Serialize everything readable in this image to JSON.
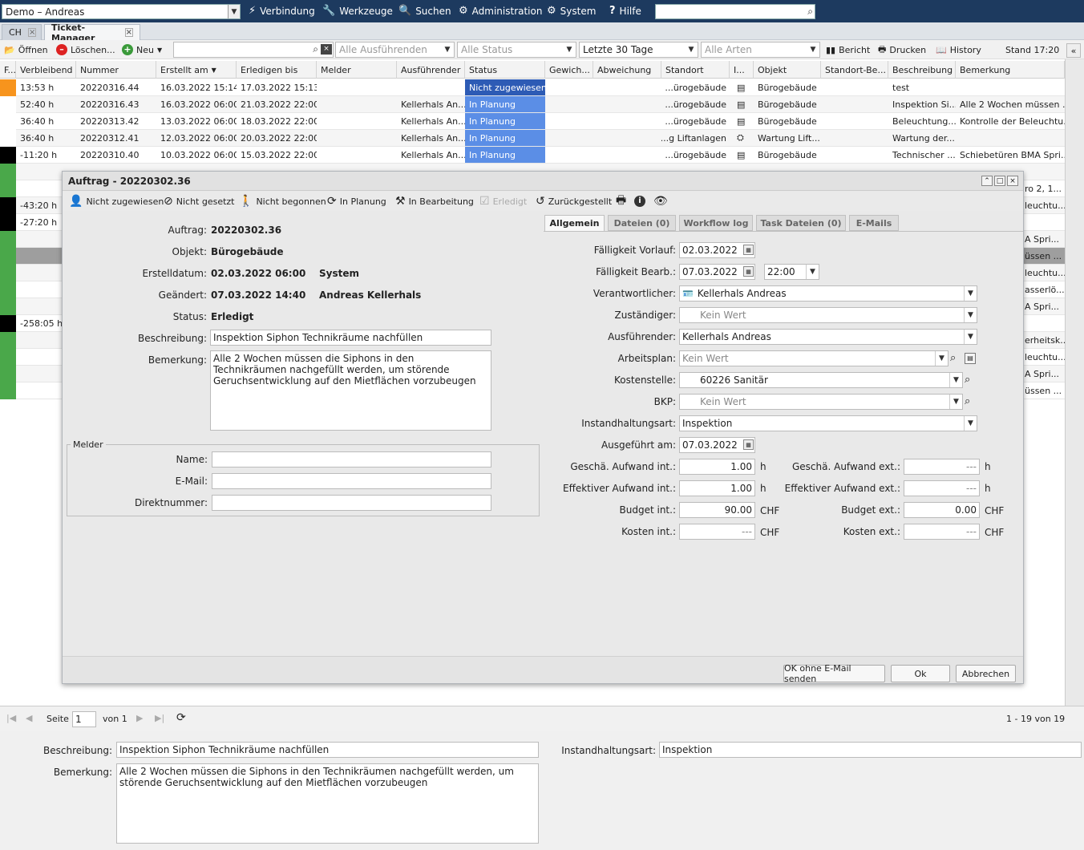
{
  "topbar": {
    "workspace": "Demo – Andreas",
    "menu": [
      {
        "label": "Verbindung",
        "icon": "lightning-icon"
      },
      {
        "label": "Werkzeuge",
        "icon": "wrench-icon"
      },
      {
        "label": "Suchen",
        "icon": "search-icon"
      },
      {
        "label": "Administration",
        "icon": "gears-icon"
      },
      {
        "label": "System",
        "icon": "gear-icon"
      },
      {
        "label": "Hilfe",
        "icon": "help-icon"
      }
    ],
    "search_value": ""
  },
  "tabs": [
    {
      "label": "CH"
    },
    {
      "label": "Ticket-Manager"
    }
  ],
  "toolbar": {
    "open": "Öffnen",
    "delete": "Löschen...",
    "new": "Neu",
    "filter_executor": "Alle Ausführenden",
    "filter_status": "Alle Status",
    "filter_period": "Letzte 30 Tage",
    "filter_kind": "Alle Arten",
    "report": "Bericht",
    "print": "Drucken",
    "history": "History",
    "stand": "Stand 17:20"
  },
  "grid": {
    "columns": [
      "F...",
      "Verbleibend",
      "Nummer",
      "Erstellt am",
      "Erledigen bis",
      "Melder",
      "Ausführender",
      "Status",
      "Gewich...",
      "Abweichung",
      "Standort",
      "I...",
      "Objekt",
      "Standort-Be...",
      "Beschreibung",
      "Bemerkung"
    ],
    "rows": [
      {
        "flag": "#f7941d",
        "verbleibend": "13:53 h",
        "nummer": "20220316.44",
        "erstellt": "16.03.2022 15:14",
        "erledigen": "17.03.2022 15:13",
        "ausf": "",
        "status": "Nicht zugewiesen",
        "standort": "...ürogebäude",
        "objekt": "Bürogebäude",
        "beschreibung": "test",
        "bemerkung": ""
      },
      {
        "flag": "#ffffff",
        "verbleibend": "52:40 h",
        "nummer": "20220316.43",
        "erstellt": "16.03.2022 06:00",
        "erledigen": "21.03.2022 22:00",
        "ausf": "Kellerhals An...",
        "status": "In Planung",
        "standort": "...ürogebäude",
        "objekt": "Bürogebäude",
        "beschreibung": "Inspektion Si...",
        "bemerkung": "Alle 2 Wochen müssen ..."
      },
      {
        "flag": "#ffffff",
        "verbleibend": "36:40 h",
        "nummer": "20220313.42",
        "erstellt": "13.03.2022 06:00",
        "erledigen": "18.03.2022 22:00",
        "ausf": "Kellerhals An...",
        "status": "In Planung",
        "standort": "...ürogebäude",
        "objekt": "Bürogebäude",
        "beschreibung": "Beleuchtung...",
        "bemerkung": "Kontrolle der Beleuchtu..."
      },
      {
        "flag": "#ffffff",
        "verbleibend": "36:40 h",
        "nummer": "20220312.41",
        "erstellt": "12.03.2022 06:00",
        "erledigen": "20.03.2022 22:00",
        "ausf": "Kellerhals An...",
        "status": "In Planung",
        "standort": "...g Liftanlagen",
        "objekt": "Wartung Lift...",
        "beschreibung": "Wartung der...",
        "bemerkung": ""
      },
      {
        "flag": "#000000",
        "verbleibend": "-11:20 h",
        "nummer": "20220310.40",
        "erstellt": "10.03.2022 06:00",
        "erledigen": "15.03.2022 22:00",
        "ausf": "Kellerhals An...",
        "status": "In Planung",
        "standort": "...ürogebäude",
        "objekt": "Bürogebäude",
        "beschreibung": "Technischer ...",
        "bemerkung": "Schiebetüren BMA Spri..."
      }
    ],
    "hidden_rows": [
      {
        "flag": "#4aa84a",
        "verbleibend": "",
        "bemerkung": ""
      },
      {
        "flag": "#4aa84a",
        "verbleibend": "",
        "bemerkung": "ro 2, 1..."
      },
      {
        "flag": "#000000",
        "verbleibend": "-43:20 h",
        "bemerkung": "leuchtu..."
      },
      {
        "flag": "#000000",
        "verbleibend": "-27:20 h",
        "bemerkung": ""
      },
      {
        "flag": "#4aa84a",
        "verbleibend": "",
        "bemerkung": "A Spri..."
      },
      {
        "flag": "#4aa84a",
        "verbleibend": "",
        "bemerkung": "üssen ..."
      },
      {
        "flag": "#4aa84a",
        "verbleibend": "",
        "bemerkung": "leuchtu..."
      },
      {
        "flag": "#4aa84a",
        "verbleibend": "",
        "bemerkung": "asserlö..."
      },
      {
        "flag": "#4aa84a",
        "verbleibend": "",
        "bemerkung": "A Spri..."
      },
      {
        "flag": "#000000",
        "verbleibend": "-258:05 h",
        "bemerkung": ""
      },
      {
        "flag": "#4aa84a",
        "verbleibend": "",
        "bemerkung": "erheitsk..."
      },
      {
        "flag": "#4aa84a",
        "verbleibend": "",
        "bemerkung": "leuchtu..."
      },
      {
        "flag": "#4aa84a",
        "verbleibend": "",
        "bemerkung": "A Spri..."
      },
      {
        "flag": "#4aa84a",
        "verbleibend": "",
        "bemerkung": "üssen ..."
      }
    ]
  },
  "dialog": {
    "title": "Auftrag - 20220302.36",
    "tools": [
      {
        "label": "Nicht zugewiesen",
        "icon": "user-icon"
      },
      {
        "label": "Nicht gesetzt",
        "icon": "block-icon"
      },
      {
        "label": "Nicht begonnen",
        "icon": "walk-icon"
      },
      {
        "label": "In Planung",
        "icon": "refresh-icon"
      },
      {
        "label": "In Bearbeitung",
        "icon": "hammer-icon"
      },
      {
        "label": "Erledigt",
        "icon": "check-icon"
      },
      {
        "label": "Zurückgestellt",
        "icon": "undo-icon"
      }
    ],
    "tabs": [
      "Allgemein",
      "Dateien  (0)",
      "Workflow log",
      "Task Dateien  (0)",
      "E-Mails"
    ],
    "left": {
      "auftrag_label": "Auftrag:",
      "auftrag": "20220302.36",
      "objekt_label": "Objekt:",
      "objekt": "Bürogebäude",
      "erstellt_label": "Erstelldatum:",
      "erstellt": "02.03.2022 06:00",
      "erstellt_by": "System",
      "geaendert_label": "Geändert:",
      "geaendert": "07.03.2022 14:40",
      "geaendert_by": "Andreas Kellerhals",
      "status_label": "Status:",
      "status": "Erledigt",
      "beschreibung_label": "Beschreibung:",
      "beschreibung": "Inspektion Siphon Technikräume nachfüllen",
      "bemerkung_label": "Bemerkung:",
      "bemerkung": "Alle 2 Wochen müssen die Siphons in den Technikräumen nachgefüllt werden, um störende Geruchsentwicklung auf den Mietflächen vorzubeugen",
      "melder_legend": "Melder",
      "name_label": "Name:",
      "email_label": "E-Mail:",
      "direkt_label": "Direktnummer:"
    },
    "right": {
      "faellig_vorlauf_label": "Fälligkeit Vorlauf:",
      "faellig_vorlauf": "02.03.2022",
      "faellig_bearb_label": "Fälligkeit Bearb.:",
      "faellig_bearb": "07.03.2022",
      "faellig_bearb_time": "22:00",
      "verantwortlicher_label": "Verantwortlicher:",
      "verantwortlicher": "Kellerhals Andreas",
      "zustaendiger_label": "Zuständiger:",
      "zustaendiger": "Kein Wert",
      "ausfuehrender_label": "Ausführender:",
      "ausfuehrender": "Kellerhals Andreas",
      "arbeitsplan_label": "Arbeitsplan:",
      "arbeitsplan": "Kein Wert",
      "kostenstelle_label": "Kostenstelle:",
      "kostenstelle": "60226 Sanitär",
      "bkp_label": "BKP:",
      "bkp": "Kein Wert",
      "instandhaltungsart_label": "Instandhaltungsart:",
      "instandhaltungsart": "Inspektion",
      "ausgefuehrt_label": "Ausgeführt am:",
      "ausgefuehrt": "07.03.2022",
      "gesch_int_label": "Geschä. Aufwand int.:",
      "gesch_int": "1.00",
      "eff_int_label": "Effektiver Aufwand int.:",
      "eff_int": "1.00",
      "budget_int_label": "Budget int.:",
      "budget_int": "90.00",
      "kosten_int_label": "Kosten int.:",
      "kosten_int": "---",
      "gesch_ext_label": "Geschä. Aufwand ext.:",
      "gesch_ext": "---",
      "eff_ext_label": "Effektiver Aufwand ext.:",
      "eff_ext": "---",
      "budget_ext_label": "Budget ext.:",
      "budget_ext": "0.00",
      "kosten_ext_label": "Kosten ext.:",
      "kosten_ext": "---",
      "unit_h": "h",
      "unit_chf": "CHF"
    },
    "buttons": {
      "ok_no_mail": "OK ohne E-Mail senden",
      "ok": "Ok",
      "cancel": "Abbrechen"
    }
  },
  "pager": {
    "seite_label": "Seite",
    "page": "1",
    "von": "von 1",
    "count": "1 - 19 von 19"
  },
  "bottom": {
    "beschreibung_label": "Beschreibung:",
    "beschreibung": "Inspektion Siphon Technikräume nachfüllen",
    "bemerkung_label": "Bemerkung:",
    "bemerkung": "Alle 2 Wochen müssen die Siphons in den Technikräumen nachgefüllt werden, um störende Geruchsentwicklung auf den Mietflächen vorzubeugen",
    "instandhaltungsart_label": "Instandhaltungsart:",
    "instandhaltungsart": "Inspektion"
  }
}
